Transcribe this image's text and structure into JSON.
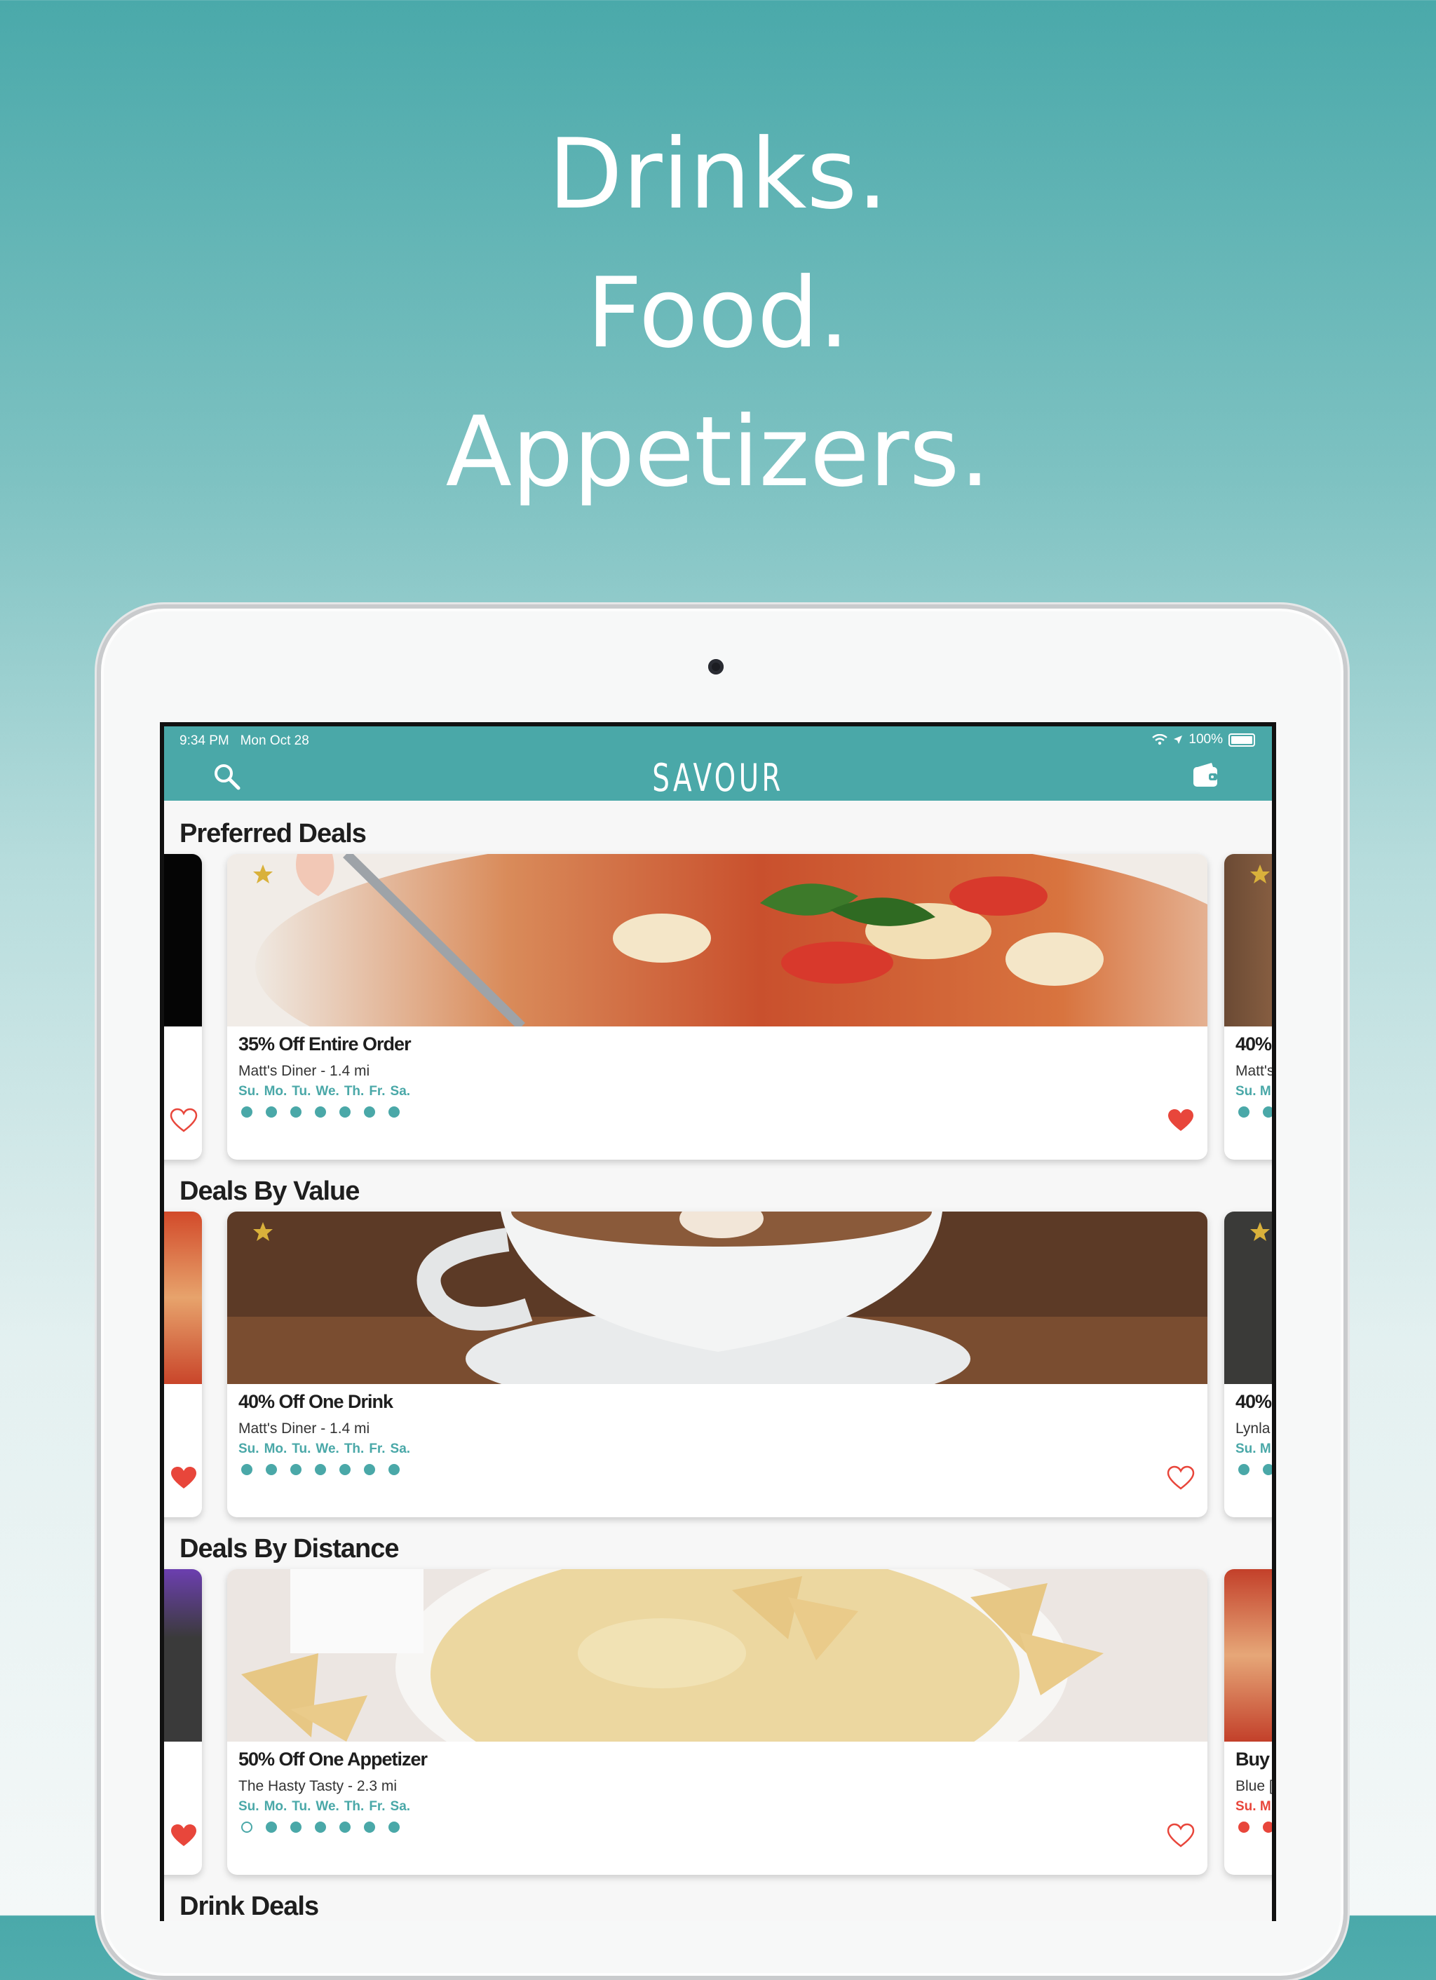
{
  "headline": {
    "line1": "Drinks.",
    "line2": "Food.",
    "line3": "Appetizers."
  },
  "status_bar": {
    "time": "9:34 PM",
    "date": "Mon Oct 28",
    "battery": "100%"
  },
  "nav": {
    "logo": "SAVOUR",
    "search_icon": "search-icon",
    "wallet_icon": "wallet-icon"
  },
  "sections": [
    {
      "title": "Preferred Deals",
      "main_card": {
        "title": "35% Off Entire Order",
        "subtitle": "Matt's Diner - 1.4 mi",
        "days": [
          "Su.",
          "Mo.",
          "Tu.",
          "We.",
          "Th.",
          "Fr.",
          "Sa."
        ],
        "favorited": true
      },
      "right_card": {
        "title": "40%",
        "subtitle": "Matt's",
        "days": "Su. M"
      }
    },
    {
      "title": "Deals By Value",
      "main_card": {
        "title": "40% Off One Drink",
        "subtitle": "Matt's Diner - 1.4 mi",
        "days": [
          "Su.",
          "Mo.",
          "Tu.",
          "We.",
          "Th.",
          "Fr.",
          "Sa."
        ],
        "favorited": false
      },
      "right_card": {
        "title": "40%",
        "subtitle": "Lynla",
        "days": "Su. M"
      }
    },
    {
      "title": "Deals By Distance",
      "main_card": {
        "title": "50% Off One Appetizer",
        "subtitle": "The Hasty Tasty - 2.3 mi",
        "days": [
          "Su.",
          "Mo.",
          "Tu.",
          "We.",
          "Th.",
          "Fr.",
          "Sa."
        ],
        "favorited": false
      },
      "right_card": {
        "title": "Buy",
        "subtitle": "Blue [",
        "days": "Su. M"
      }
    },
    {
      "title": "Drink Deals"
    }
  ],
  "colors": {
    "brand": "#4aa8a8",
    "heart": "#e8463b",
    "star": "#d9b13b"
  }
}
